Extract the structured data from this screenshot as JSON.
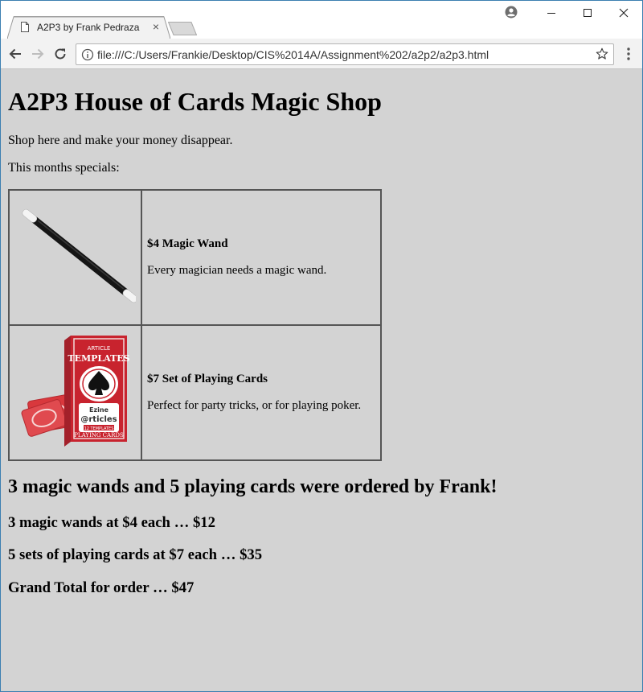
{
  "browser": {
    "tab_title": "A2P3 by Frank Pedraza",
    "tab_close": "×",
    "url": "file:///C:/Users/Frankie/Desktop/CIS%2014A/Assignment%202/a2p2/a2p3.html",
    "icons": [
      "page-icon",
      "profile-icon",
      "minimize-icon",
      "maximize-icon",
      "close-icon",
      "back-icon",
      "forward-icon",
      "reload-icon",
      "info-icon",
      "star-icon",
      "menu-icon"
    ]
  },
  "page": {
    "heading": "A2P3 House of Cards Magic Shop",
    "tagline": "Shop here and make your money disappear.",
    "specials_intro": "This months specials:",
    "items": [
      {
        "title": "$4 Magic Wand",
        "description": "Every magician needs a magic wand.",
        "image": "magic-wand"
      },
      {
        "title": "$7 Set of Playing Cards",
        "description": "Perfect for party tricks, or for playing poker.",
        "image": "playing-cards"
      }
    ],
    "order_summary": "3 magic wands and 5 playing cards were ordered by Frank!",
    "line1": "3 magic wands at $4 each … $12",
    "line2": "5 sets of playing cards at $7 each … $35",
    "grand_total": "Grand Total for order … $47"
  },
  "card_box": {
    "top_text": "ARTICLE",
    "brand": "TEMPLATES",
    "logo_small": "Ezine",
    "logo_large": "@rticles",
    "badge": "12 TEMPLATES",
    "bottom_text": "PLAYING CARDS"
  }
}
